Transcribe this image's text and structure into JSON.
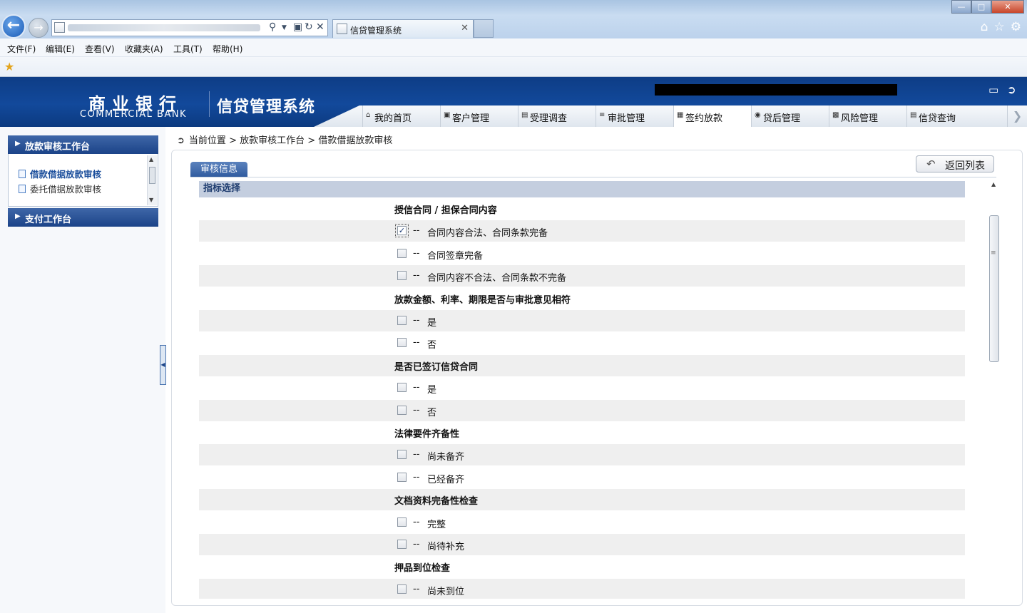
{
  "browser": {
    "tab_title": "信贷管理系统",
    "menu": [
      "文件(F)",
      "编辑(E)",
      "查看(V)",
      "收藏夹(A)",
      "工具(T)",
      "帮助(H)"
    ]
  },
  "header": {
    "bank_cn": "商业银行",
    "bank_en": "COMMERCIAL BANK",
    "system_name": "信贷管理系统",
    "nav_tabs": [
      {
        "label": "我的首页",
        "icon": "home-icon"
      },
      {
        "label": "客户管理",
        "icon": "customer-icon"
      },
      {
        "label": "受理调查",
        "icon": "survey-icon"
      },
      {
        "label": "审批管理",
        "icon": "approval-icon"
      },
      {
        "label": "签约放款",
        "icon": "contract-icon",
        "active": true
      },
      {
        "label": "贷后管理",
        "icon": "postloan-icon"
      },
      {
        "label": "风险管理",
        "icon": "risk-icon"
      },
      {
        "label": "信贷查询",
        "icon": "query-icon"
      }
    ]
  },
  "sidebar": {
    "section1": "放款审核工作台",
    "items": [
      "借款借据放款审核",
      "委托借据放款审核"
    ],
    "section2": "支付工作台"
  },
  "breadcrumb": {
    "current": "当前位置",
    "path1": "放款审核工作台",
    "path2": "借款借据放款审核",
    "sep": ">"
  },
  "content": {
    "tab_label": "审核信息",
    "return_label": "返回列表",
    "section_title": "指标选择",
    "dash": "--",
    "rows": [
      {
        "kind": "q",
        "text": "授信合同 / 担保合同内容"
      },
      {
        "kind": "o",
        "text": "合同内容合法、合同条款完备",
        "checked": true
      },
      {
        "kind": "o",
        "text": "合同签章完备",
        "checked": false
      },
      {
        "kind": "o",
        "text": "合同内容不合法、合同条款不完备",
        "checked": false
      },
      {
        "kind": "q",
        "text": "放款金额、利率、期限是否与审批意见相符"
      },
      {
        "kind": "o",
        "text": "是",
        "checked": false
      },
      {
        "kind": "o",
        "text": "否",
        "checked": false
      },
      {
        "kind": "q",
        "text": "是否已签订信贷合同"
      },
      {
        "kind": "o",
        "text": "是",
        "checked": false
      },
      {
        "kind": "o",
        "text": "否",
        "checked": false
      },
      {
        "kind": "q",
        "text": "法律要件齐备性"
      },
      {
        "kind": "o",
        "text": "尚未备齐",
        "checked": false
      },
      {
        "kind": "o",
        "text": "已经备齐",
        "checked": false
      },
      {
        "kind": "q",
        "text": "文档资料完备性检查"
      },
      {
        "kind": "o",
        "text": "完整",
        "checked": false
      },
      {
        "kind": "o",
        "text": "尚待补充",
        "checked": false
      },
      {
        "kind": "q",
        "text": "押品到位检查"
      },
      {
        "kind": "o",
        "text": "尚未到位",
        "checked": false
      }
    ]
  }
}
